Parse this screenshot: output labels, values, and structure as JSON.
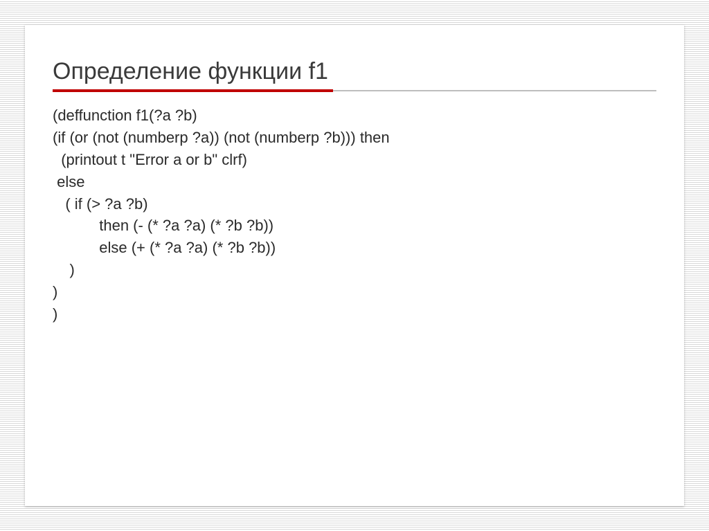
{
  "title": "Определение функции f1",
  "code": "(deffunction f1(?a ?b)\n(if (or (not (numberp ?a)) (not (numberp ?b))) then\n  (printout t \"Error a or b\" clrf)\n else\n   ( if (> ?a ?b)\n           then (- (* ?a ?a) (* ?b ?b))\n           else (+ (* ?a ?a) (* ?b ?b))\n    )\n)\n)"
}
